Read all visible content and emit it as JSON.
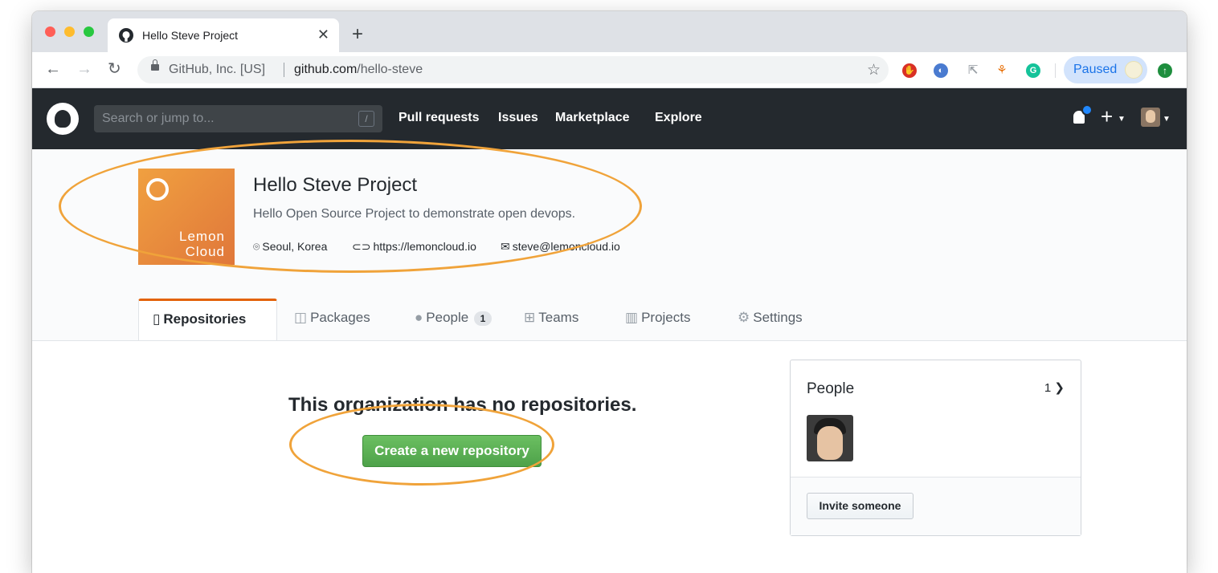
{
  "browser": {
    "tab_title": "Hello Steve Project",
    "site_identity": "GitHub, Inc. [US]",
    "url_host": "github.com",
    "url_path": "/hello-steve",
    "profile_status": "Paused"
  },
  "gh_header": {
    "search_placeholder": "Search or jump to...",
    "search_shortcut": "/",
    "nav": [
      "Pull requests",
      "Issues",
      "Marketplace",
      "Explore"
    ]
  },
  "org": {
    "logo_text_line1": "Lemon",
    "logo_text_line2": "Cloud",
    "name": "Hello Steve Project",
    "description": "Hello Open Source Project to demonstrate open devops.",
    "location": "Seoul, Korea",
    "website": "https://lemoncloud.io",
    "email": "steve@lemoncloud.io"
  },
  "tabs": {
    "repositories": "Repositories",
    "packages": "Packages",
    "people": "People",
    "people_count": "1",
    "teams": "Teams",
    "projects": "Projects",
    "settings": "Settings"
  },
  "main": {
    "empty_title": "This organization has no repositories.",
    "create_button": "Create a new repository"
  },
  "people_box": {
    "title": "People",
    "count": "1",
    "invite_button": "Invite someone"
  },
  "colors": {
    "header_bg": "#24292e",
    "accent_tab": "#e36209",
    "primary_button": "#4ea24a",
    "annotation": "#f0a33a",
    "org_logo": "#e0773a"
  }
}
